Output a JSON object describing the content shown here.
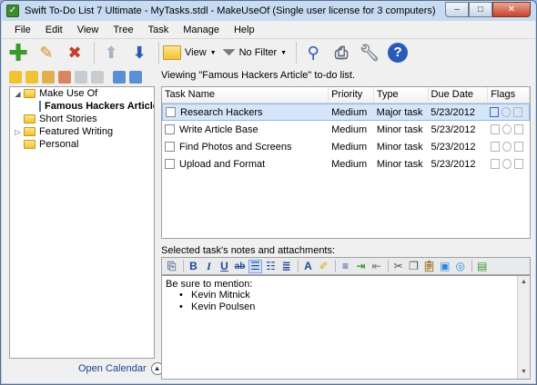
{
  "window": {
    "title": "Swift To-Do List 7 Ultimate - MyTasks.stdl - MakeUseOf (Single user license for 3 computers)",
    "minimize": "–",
    "maximize": "□",
    "close": "✕"
  },
  "menu": [
    "File",
    "Edit",
    "View",
    "Tree",
    "Task",
    "Manage",
    "Help"
  ],
  "toolbar": {
    "view_label": "View",
    "filter_label": "No Filter"
  },
  "tree": {
    "items": [
      {
        "label": "Make Use Of",
        "level": 0,
        "type": "folder",
        "expanded": true
      },
      {
        "label": "Famous Hackers Article",
        "level": 1,
        "type": "list",
        "selected": true
      },
      {
        "label": "Short Stories",
        "level": 0,
        "type": "folder"
      },
      {
        "label": "Featured Writing",
        "level": 0,
        "type": "folder",
        "collapsed": true
      },
      {
        "label": "Personal",
        "level": 0,
        "type": "folder"
      }
    ],
    "open_calendar": "Open Calendar"
  },
  "viewing_text": "Viewing \"Famous Hackers Article\" to-do list.",
  "task_table": {
    "columns": [
      "Task Name",
      "Priority",
      "Type",
      "Due Date",
      "Flags"
    ],
    "rows": [
      {
        "name": "Research Hackers",
        "priority": "Medium",
        "type": "Major task",
        "due": "5/23/2012",
        "selected": true
      },
      {
        "name": "Write Article Base",
        "priority": "Medium",
        "type": "Minor task",
        "due": "5/23/2012"
      },
      {
        "name": "Find Photos and Screens",
        "priority": "Medium",
        "type": "Minor task",
        "due": "5/23/2012"
      },
      {
        "name": "Upload and Format",
        "priority": "Medium",
        "type": "Minor task",
        "due": "5/23/2012"
      }
    ]
  },
  "notes": {
    "label": "Selected task's notes and attachments:",
    "intro": "Be sure to mention:",
    "bullets": [
      "Kevin Mitnick",
      "Kevin Poulsen"
    ]
  },
  "editor_toolbar": {
    "bold": "B",
    "italic": "I",
    "underline": "U",
    "strike": "ab",
    "font_color": "A"
  },
  "colors": {
    "accent": "#2a5bb6",
    "selection": "#d6e6fa",
    "folder": "#f1c233",
    "add_button": "#3c9a2a",
    "delete_button": "#c93a2a"
  }
}
